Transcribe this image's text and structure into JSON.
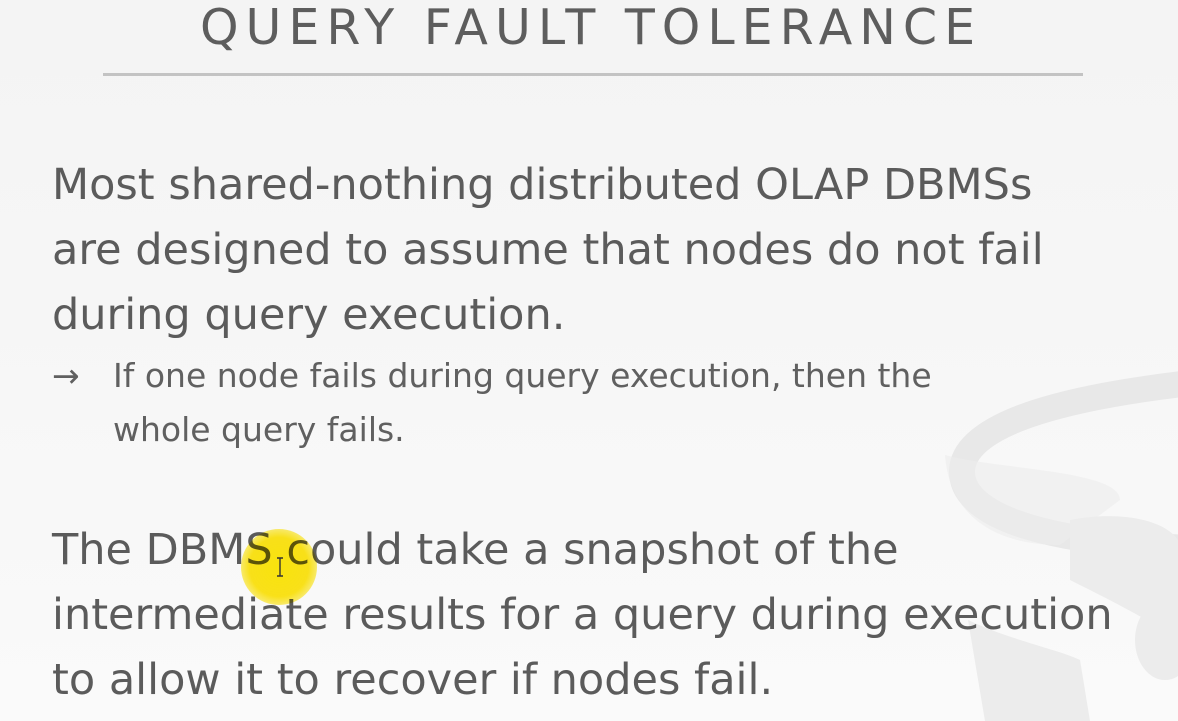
{
  "slide": {
    "title": "QUERY FAULT TOLERANCE",
    "paragraph_1": [
      "Most shared-nothing distributed OLAP DBMSs",
      "are designed to assume that nodes do not fail",
      "during query execution."
    ],
    "bullet": {
      "arrow": "→",
      "lines": [
        "If one node fails during query execution, then the",
        "whole query fails."
      ]
    },
    "paragraph_2": [
      "The DBMS could take a snapshot of the",
      "intermediate results for a query during execution",
      "to allow it to recover if nodes fail."
    ]
  },
  "colors": {
    "text": "#5b5b5b",
    "title_rule": "#c3c3c3",
    "cursor_highlight": "#ffe400"
  },
  "icons": {
    "watermark": "database-logo-icon",
    "cursor": "text-cursor-icon"
  }
}
